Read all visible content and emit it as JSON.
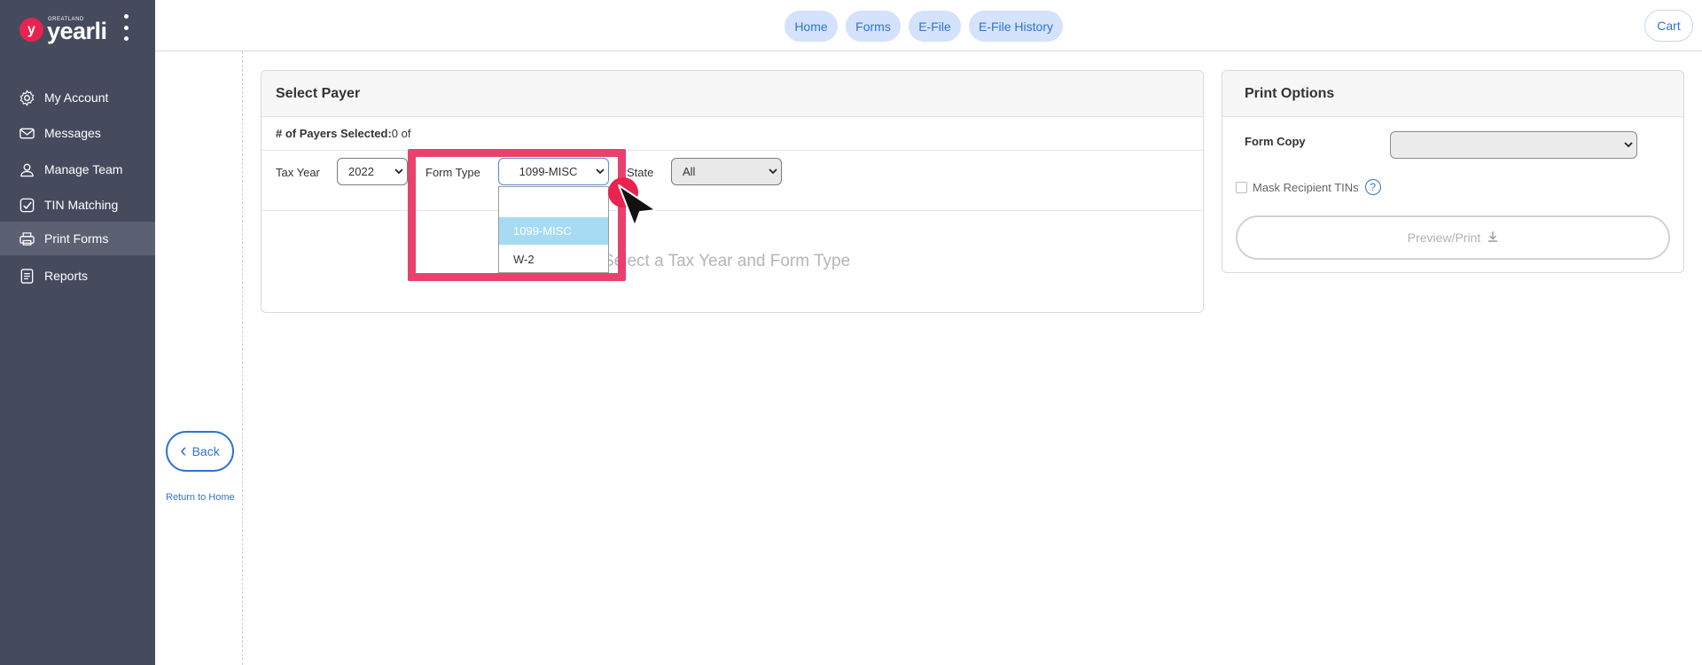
{
  "logo": {
    "small": "GREATLAND",
    "text": "yearli",
    "mark": "y"
  },
  "sidebar": {
    "items": [
      {
        "label": "My Account",
        "icon": "gear-icon"
      },
      {
        "label": "Messages",
        "icon": "envelope-icon"
      },
      {
        "label": "Manage Team",
        "icon": "user-icon"
      },
      {
        "label": "TIN Matching",
        "icon": "check-square-icon"
      },
      {
        "label": "Print Forms",
        "icon": "printer-icon",
        "active": true
      },
      {
        "label": "Reports",
        "icon": "report-icon"
      }
    ]
  },
  "topnav": {
    "home": "Home",
    "forms": "Forms",
    "efile": "E-File",
    "efile_history": "E-File History",
    "cart": "Cart"
  },
  "left": {
    "back": "Back",
    "return_home": "Return to Home"
  },
  "select_payer": {
    "title": "Select Payer",
    "payers_label": "# of Payers Selected:",
    "payers_value": "0 of",
    "tax_year_label": "Tax Year",
    "tax_year_value": "2022",
    "form_type_label": "Form Type",
    "form_type_value": "1099-MISC",
    "state_label": "State",
    "state_value": "All",
    "empty_message": "Select a Tax Year and Form Type",
    "form_type_options": [
      "",
      "1099-MISC",
      "W-2"
    ]
  },
  "print_options": {
    "title": "Print Options",
    "form_copy_label": "Form Copy",
    "form_copy_value": "",
    "mask_label": "Mask Recipient TINs",
    "help": "?",
    "preview_label": "Preview/Print"
  },
  "colors": {
    "sidebar_bg": "#454b5d",
    "accent": "#2f72d4",
    "highlight": "#e8426c",
    "brand_red": "#e8234f"
  }
}
